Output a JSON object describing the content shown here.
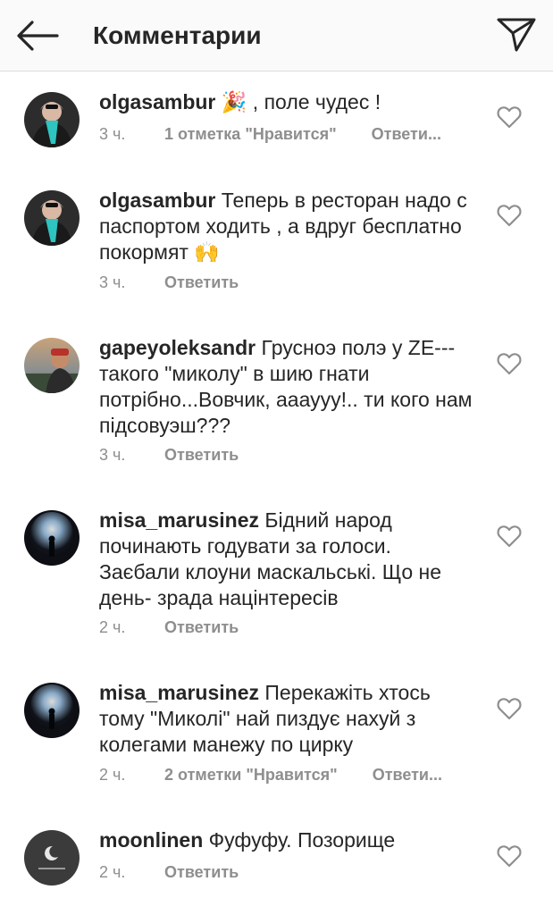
{
  "header": {
    "title": "Комментарии"
  },
  "comments": [
    {
      "username": "olgasambur",
      "text": "🎉 , поле чудес !",
      "time": "3 ч.",
      "likes": "1 отметка \"Нравится\"",
      "reply": "Ответи..."
    },
    {
      "username": "olgasambur",
      "text": "Теперь в ресторан надо с паспортом ходить , а вдруг бесплатно покормят 🙌",
      "time": "3 ч.",
      "likes": "",
      "reply": "Ответить"
    },
    {
      "username": "gapeyoleksandr",
      "text": "Грусноэ полэ у ZE--- такого \"миколу\" в шию гнати потрібно...Вовчик, аааууу!.. ти кого нам підсовуэш???",
      "time": "3 ч.",
      "likes": "",
      "reply": "Ответить"
    },
    {
      "username": "misa_marusinez",
      "text": "Бідний народ починають годувати за голоси. Заєбали клоуни маскальські. Що не день- зрада націнтересів",
      "time": "2 ч.",
      "likes": "",
      "reply": "Ответить"
    },
    {
      "username": "misa_marusinez",
      "text": "Перекажіть хтось тому \"Миколі\" най пиздує нахуй з колегами манежу по цирку",
      "time": "2 ч.",
      "likes": "2 отметки \"Нравится\"",
      "reply": "Ответи..."
    },
    {
      "username": "moonlinen",
      "text": "Фуфуфу. Позорище",
      "time": "2 ч.",
      "likes": "",
      "reply": "Ответить"
    }
  ],
  "icons": {
    "back": "arrow-left-icon",
    "send": "paper-plane-icon",
    "like": "heart-outline-icon"
  },
  "colors": {
    "header_bg": "#fafafa",
    "text": "#262626",
    "meta": "#8e8e8e",
    "divider": "#dbdbdb"
  }
}
